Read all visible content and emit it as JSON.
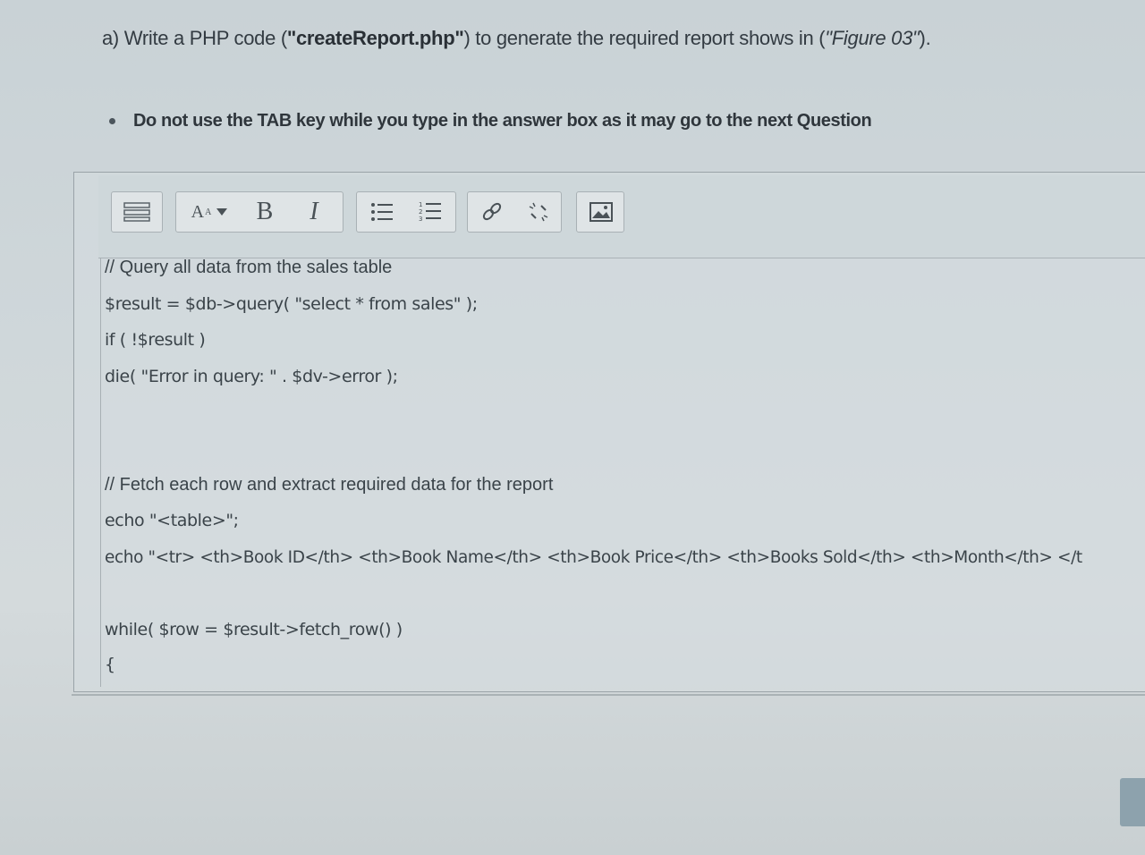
{
  "question": {
    "prefix": "a)  Write a PHP code (",
    "filename": "\"createReport.php\"",
    "middle": ") to generate the required report shows in (",
    "figure": "\"Figure 03\"",
    "suffix": ")."
  },
  "note": "Do not use the TAB key while you type in the answer box as it may go to the next Question",
  "toolbar": {
    "buttons": [
      "expand-toolbar",
      "font-size",
      "bold",
      "italic",
      "unordered-list",
      "ordered-list",
      "link",
      "unlink",
      "image"
    ],
    "bold_label": "B",
    "italic_label": "I",
    "font_label": "A"
  },
  "answer": {
    "lines": [
      "// Query all data from the sales table",
      "$result = $db->query( \"select * from sales\" );",
      "if ( !$result )",
      "die( \"Error in query: \" . $dv->error );",
      "// Fetch each row  and extract required data for the report",
      "echo \"<table>\";",
      "echo \"<tr> <th>Book ID</th> <th>Book Name</th> <th>Book Price</th> <th>Books Sold</th> <th>Month</th>  </t",
      "while( $row = $result->fetch_row() )",
      "{"
    ]
  }
}
